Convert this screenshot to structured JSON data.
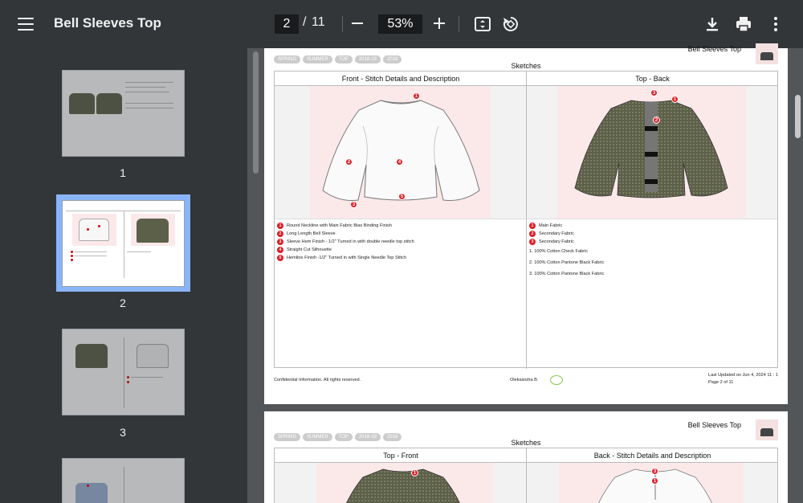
{
  "toolbar": {
    "title": "Bell Sleeves Top",
    "current_page": "2",
    "separator": "/",
    "total_pages": "11",
    "zoom": "53%"
  },
  "sidebar": {
    "thumbnails": [
      {
        "number": "1"
      },
      {
        "number": "2"
      },
      {
        "number": "3"
      }
    ]
  },
  "page1": {
    "header_title": "Bell Sleeves Top",
    "tags": [
      "SPRING",
      "SUMMER",
      "TOP",
      "2018-19",
      "2018"
    ],
    "section": "Sketches",
    "left_heading": "Front - Stitch Details and Description",
    "right_heading": "Top - Back",
    "left_notes": [
      {
        "num": "1",
        "text": "Round Neckline with Main Fabric Bias Binding Finish"
      },
      {
        "num": "2",
        "text": "Long Length Bell Sleeve"
      },
      {
        "num": "3",
        "text": "Sleeve Hem Finish - 1/2\" Turned in with double needle top stitch"
      },
      {
        "num": "4",
        "text": "Straight Cut Silhouette"
      },
      {
        "num": "5",
        "text": "Hemline Finish  -1/2\" Turned in with Single Needle Top Stitch"
      }
    ],
    "right_notes": [
      {
        "num": "1",
        "text": "Main Fabric"
      },
      {
        "num": "2",
        "text": "Secondary Fabric"
      },
      {
        "num": "3",
        "text": "Secondary Fabric"
      }
    ],
    "fabric_lines": [
      "1. 100% Cotton Check Fabric",
      "2.  100% Cotton Pantone Black Fabric",
      "3. 100% Cotton Pantone Black Fabric"
    ],
    "footer_left": "Confidential Information. All rights reserved.",
    "footer_author": "Oleksandra B.",
    "footer_updated": "Last Updated on Jun 4, 2024 11 : 1",
    "footer_page": "Page 2 of 11"
  },
  "page2": {
    "header_title": "Bell Sleeves Top",
    "tags": [
      "SPRING",
      "SUMMER",
      "TOP",
      "2018-19",
      "2018"
    ],
    "section": "Sketches",
    "left_heading": "Top - Front",
    "right_heading": "Back - Stitch Details and Description"
  },
  "colors": {
    "toolbar_bg": "#323639",
    "viewer_bg": "#525659",
    "selection": "#8ab4f8",
    "marker_red": "#e01e26",
    "fabric_olive": "#5d6049"
  },
  "icons": [
    "menu-icon",
    "fit-page-icon",
    "rotate-icon",
    "download-icon",
    "print-icon",
    "more-vert-icon"
  ]
}
